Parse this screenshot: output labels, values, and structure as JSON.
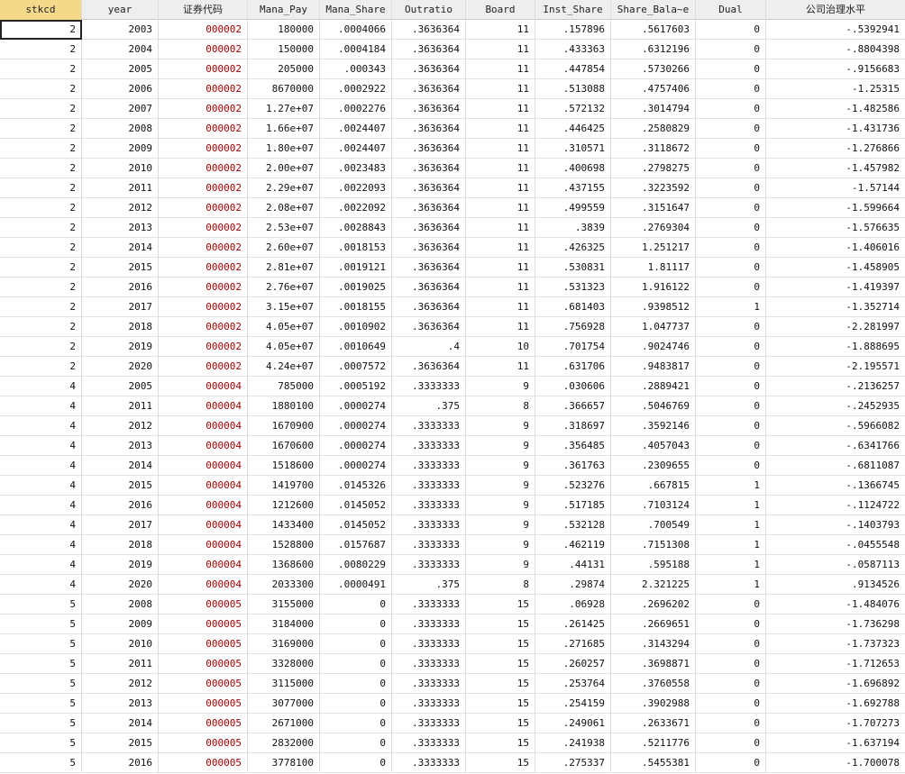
{
  "headers": [
    "stkcd",
    "year",
    "证券代码",
    "Mana_Pay",
    "Mana_Share",
    "Outratio",
    "Board",
    "Inst_Share",
    "Share_Bala~e",
    "Dual",
    "公司治理水平"
  ],
  "rows": [
    [
      "2",
      "2003",
      "000002",
      "180000",
      ".0004066",
      ".3636364",
      "11",
      ".157896",
      ".5617603",
      "0",
      "-.5392941"
    ],
    [
      "2",
      "2004",
      "000002",
      "150000",
      ".0004184",
      ".3636364",
      "11",
      ".433363",
      ".6312196",
      "0",
      "-.8804398"
    ],
    [
      "2",
      "2005",
      "000002",
      "205000",
      ".000343",
      ".3636364",
      "11",
      ".447854",
      ".5730266",
      "0",
      "-.9156683"
    ],
    [
      "2",
      "2006",
      "000002",
      "8670000",
      ".0002922",
      ".3636364",
      "11",
      ".513088",
      ".4757406",
      "0",
      "-1.25315"
    ],
    [
      "2",
      "2007",
      "000002",
      "1.27e+07",
      ".0002276",
      ".3636364",
      "11",
      ".572132",
      ".3014794",
      "0",
      "-1.482586"
    ],
    [
      "2",
      "2008",
      "000002",
      "1.66e+07",
      ".0024407",
      ".3636364",
      "11",
      ".446425",
      ".2580829",
      "0",
      "-1.431736"
    ],
    [
      "2",
      "2009",
      "000002",
      "1.80e+07",
      ".0024407",
      ".3636364",
      "11",
      ".310571",
      ".3118672",
      "0",
      "-1.276866"
    ],
    [
      "2",
      "2010",
      "000002",
      "2.00e+07",
      ".0023483",
      ".3636364",
      "11",
      ".400698",
      ".2798275",
      "0",
      "-1.457982"
    ],
    [
      "2",
      "2011",
      "000002",
      "2.29e+07",
      ".0022093",
      ".3636364",
      "11",
      ".437155",
      ".3223592",
      "0",
      "-1.57144"
    ],
    [
      "2",
      "2012",
      "000002",
      "2.08e+07",
      ".0022092",
      ".3636364",
      "11",
      ".499559",
      ".3151647",
      "0",
      "-1.599664"
    ],
    [
      "2",
      "2013",
      "000002",
      "2.53e+07",
      ".0028843",
      ".3636364",
      "11",
      ".3839",
      ".2769304",
      "0",
      "-1.576635"
    ],
    [
      "2",
      "2014",
      "000002",
      "2.60e+07",
      ".0018153",
      ".3636364",
      "11",
      ".426325",
      "1.251217",
      "0",
      "-1.406016"
    ],
    [
      "2",
      "2015",
      "000002",
      "2.81e+07",
      ".0019121",
      ".3636364",
      "11",
      ".530831",
      "1.81117",
      "0",
      "-1.458905"
    ],
    [
      "2",
      "2016",
      "000002",
      "2.76e+07",
      ".0019025",
      ".3636364",
      "11",
      ".531323",
      "1.916122",
      "0",
      "-1.419397"
    ],
    [
      "2",
      "2017",
      "000002",
      "3.15e+07",
      ".0018155",
      ".3636364",
      "11",
      ".681403",
      ".9398512",
      "1",
      "-1.352714"
    ],
    [
      "2",
      "2018",
      "000002",
      "4.05e+07",
      ".0010902",
      ".3636364",
      "11",
      ".756928",
      "1.047737",
      "0",
      "-2.281997"
    ],
    [
      "2",
      "2019",
      "000002",
      "4.05e+07",
      ".0010649",
      ".4",
      "10",
      ".701754",
      ".9024746",
      "0",
      "-1.888695"
    ],
    [
      "2",
      "2020",
      "000002",
      "4.24e+07",
      ".0007572",
      ".3636364",
      "11",
      ".631706",
      ".9483817",
      "0",
      "-2.195571"
    ],
    [
      "4",
      "2005",
      "000004",
      "785000",
      ".0005192",
      ".3333333",
      "9",
      ".030606",
      ".2889421",
      "0",
      "-.2136257"
    ],
    [
      "4",
      "2011",
      "000004",
      "1880100",
      ".0000274",
      ".375",
      "8",
      ".366657",
      ".5046769",
      "0",
      "-.2452935"
    ],
    [
      "4",
      "2012",
      "000004",
      "1670900",
      ".0000274",
      ".3333333",
      "9",
      ".318697",
      ".3592146",
      "0",
      "-.5966082"
    ],
    [
      "4",
      "2013",
      "000004",
      "1670600",
      ".0000274",
      ".3333333",
      "9",
      ".356485",
      ".4057043",
      "0",
      "-.6341766"
    ],
    [
      "4",
      "2014",
      "000004",
      "1518600",
      ".0000274",
      ".3333333",
      "9",
      ".361763",
      ".2309655",
      "0",
      "-.6811087"
    ],
    [
      "4",
      "2015",
      "000004",
      "1419700",
      ".0145326",
      ".3333333",
      "9",
      ".523276",
      ".667815",
      "1",
      "-.1366745"
    ],
    [
      "4",
      "2016",
      "000004",
      "1212600",
      ".0145052",
      ".3333333",
      "9",
      ".517185",
      ".7103124",
      "1",
      "-.1124722"
    ],
    [
      "4",
      "2017",
      "000004",
      "1433400",
      ".0145052",
      ".3333333",
      "9",
      ".532128",
      ".700549",
      "1",
      "-.1403793"
    ],
    [
      "4",
      "2018",
      "000004",
      "1528800",
      ".0157687",
      ".3333333",
      "9",
      ".462119",
      ".7151308",
      "1",
      "-.0455548"
    ],
    [
      "4",
      "2019",
      "000004",
      "1368600",
      ".0080229",
      ".3333333",
      "9",
      ".44131",
      ".595188",
      "1",
      "-.0587113"
    ],
    [
      "4",
      "2020",
      "000004",
      "2033300",
      ".0000491",
      ".375",
      "8",
      ".29874",
      "2.321225",
      "1",
      ".9134526"
    ],
    [
      "5",
      "2008",
      "000005",
      "3155000",
      "0",
      ".3333333",
      "15",
      ".06928",
      ".2696202",
      "0",
      "-1.484076"
    ],
    [
      "5",
      "2009",
      "000005",
      "3184000",
      "0",
      ".3333333",
      "15",
      ".261425",
      ".2669651",
      "0",
      "-1.736298"
    ],
    [
      "5",
      "2010",
      "000005",
      "3169000",
      "0",
      ".3333333",
      "15",
      ".271685",
      ".3143294",
      "0",
      "-1.737323"
    ],
    [
      "5",
      "2011",
      "000005",
      "3328000",
      "0",
      ".3333333",
      "15",
      ".260257",
      ".3698871",
      "0",
      "-1.712653"
    ],
    [
      "5",
      "2012",
      "000005",
      "3115000",
      "0",
      ".3333333",
      "15",
      ".253764",
      ".3760558",
      "0",
      "-1.696892"
    ],
    [
      "5",
      "2013",
      "000005",
      "3077000",
      "0",
      ".3333333",
      "15",
      ".254159",
      ".3902988",
      "0",
      "-1.692788"
    ],
    [
      "5",
      "2014",
      "000005",
      "2671000",
      "0",
      ".3333333",
      "15",
      ".249061",
      ".2633671",
      "0",
      "-1.707273"
    ],
    [
      "5",
      "2015",
      "000005",
      "2832000",
      "0",
      ".3333333",
      "15",
      ".241938",
      ".5211776",
      "0",
      "-1.637194"
    ],
    [
      "5",
      "2016",
      "000005",
      "3778100",
      "0",
      ".3333333",
      "15",
      ".275337",
      ".5455381",
      "0",
      "-1.700078"
    ]
  ]
}
